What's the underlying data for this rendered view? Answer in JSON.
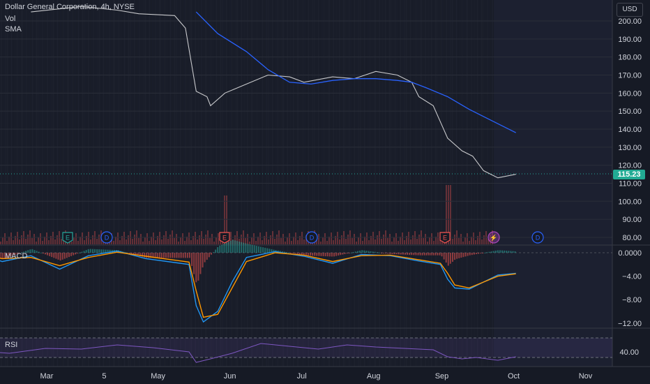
{
  "header": {
    "symbol_title": "Dollar General Corporation, 4h, NYSE",
    "indicator_vol": "Vol",
    "indicator_sma": "SMA",
    "currency_button": "USD"
  },
  "price_pane": {
    "last_price": "115.23",
    "last_price_color": "#22ab94",
    "y_ticks": [
      "200.00",
      "190.00",
      "180.00",
      "170.00",
      "160.00",
      "150.00",
      "140.00",
      "130.00",
      "120.00",
      "110.00",
      "100.00",
      "90.00",
      "80.00"
    ],
    "events": [
      {
        "label": "E",
        "kind": "earnings",
        "color": "#26a69a"
      },
      {
        "label": "D",
        "kind": "dividend",
        "color": "#2962ff"
      },
      {
        "label": "E",
        "kind": "earnings",
        "color": "#ef5350"
      },
      {
        "label": "D",
        "kind": "dividend",
        "color": "#2962ff"
      },
      {
        "label": "E",
        "kind": "earnings",
        "color": "#ef5350"
      },
      {
        "label": "⚡",
        "kind": "split",
        "color": "#ab47bc"
      },
      {
        "label": "D",
        "kind": "dividend",
        "color": "#2962ff"
      }
    ]
  },
  "macd_pane": {
    "title": "MACD",
    "y_ticks": [
      "0.0000",
      "−4.00",
      "−8.00",
      "−12.00"
    ]
  },
  "rsi_pane": {
    "title": "RSI",
    "y_ticks": [
      "40.00"
    ]
  },
  "x_axis": {
    "labels": [
      "Mar",
      "5",
      "May",
      "Jun",
      "Jul",
      "Aug",
      "Sep",
      "Oct",
      "Nov"
    ]
  },
  "colors": {
    "background": "#161a25",
    "up": "#26a69a",
    "down": "#ef5350",
    "sma": "#2962ff",
    "macd": "#2196f3",
    "signal": "#ff9800",
    "rsi": "#7e57c2"
  },
  "chart_data": {
    "type": "line",
    "title": "Dollar General Corporation, 4h, NYSE",
    "x_labels": [
      "Mar",
      "5",
      "May",
      "Jun",
      "Jul",
      "Aug",
      "Sep",
      "Oct",
      "Nov"
    ],
    "ylim": [
      75,
      205
    ],
    "series": [
      {
        "name": "Price",
        "x_month": [
          2.8,
          3.5,
          4.0,
          4.3,
          4.8,
          4.95,
          5.1,
          5.25,
          5.3,
          5.5,
          5.8,
          6.1,
          6.4,
          6.6,
          7.0,
          7.3,
          7.6,
          7.9,
          8.1,
          8.2,
          8.4,
          8.6,
          8.8,
          8.95,
          9.1,
          9.3,
          9.55
        ],
        "values": [
          205,
          208,
          206,
          204,
          203,
          196,
          161,
          158,
          153,
          160,
          165,
          170,
          169,
          166,
          169,
          168,
          172,
          170,
          166,
          158,
          153,
          135,
          128,
          125,
          117,
          113,
          115
        ]
      },
      {
        "name": "SMA",
        "x_month": [
          5.1,
          5.4,
          5.8,
          6.1,
          6.4,
          6.7,
          7.0,
          7.3,
          7.6,
          7.9,
          8.1,
          8.3,
          8.6,
          8.9,
          9.2,
          9.55
        ],
        "values": [
          205,
          193,
          183,
          173,
          166,
          165,
          167,
          168,
          168,
          167,
          166,
          163,
          158,
          151,
          145,
          138
        ]
      },
      {
        "name": "MACD",
        "x_month": [
          2.0,
          2.4,
          2.8,
          3.2,
          3.6,
          4.0,
          4.4,
          5.0,
          5.1,
          5.2,
          5.4,
          5.6,
          5.8,
          6.2,
          6.6,
          7.0,
          7.4,
          7.8,
          8.2,
          8.5,
          8.6,
          8.7,
          8.9,
          9.1,
          9.3,
          9.55
        ],
        "values": [
          0.2,
          -1.5,
          -0.5,
          -2.8,
          -0.5,
          0.3,
          -1.0,
          -2.0,
          -9.0,
          -11.8,
          -10.0,
          -5.0,
          -0.8,
          0.2,
          -0.6,
          -1.8,
          -0.3,
          -0.5,
          -1.4,
          -2.0,
          -4.5,
          -6.0,
          -6.2,
          -5.0,
          -3.8,
          -3.5
        ]
      },
      {
        "name": "Signal",
        "x_month": [
          2.0,
          2.4,
          2.8,
          3.2,
          3.6,
          4.0,
          4.4,
          5.0,
          5.1,
          5.2,
          5.4,
          5.6,
          5.8,
          6.2,
          6.6,
          7.0,
          7.4,
          7.8,
          8.2,
          8.5,
          8.6,
          8.7,
          8.9,
          9.1,
          9.3,
          9.55
        ],
        "values": [
          0.0,
          -1.0,
          -0.8,
          -2.2,
          -0.8,
          0.1,
          -0.6,
          -1.6,
          -6.5,
          -11.0,
          -10.5,
          -6.0,
          -1.5,
          0.0,
          -0.4,
          -1.5,
          -0.5,
          -0.4,
          -1.2,
          -1.8,
          -3.5,
          -5.5,
          -6.0,
          -5.0,
          -4.0,
          -3.6
        ]
      },
      {
        "name": "RSI",
        "x_month": [
          2.0,
          2.5,
          3.0,
          3.5,
          4.0,
          4.5,
          5.0,
          5.1,
          5.3,
          5.6,
          6.0,
          6.4,
          6.8,
          7.2,
          7.6,
          8.0,
          8.4,
          8.6,
          8.8,
          9.0,
          9.3,
          9.55
        ],
        "values": [
          42,
          38,
          45,
          44,
          50,
          46,
          40,
          25,
          30,
          38,
          52,
          48,
          44,
          50,
          47,
          45,
          43,
          33,
          30,
          32,
          28,
          33
        ]
      }
    ]
  }
}
